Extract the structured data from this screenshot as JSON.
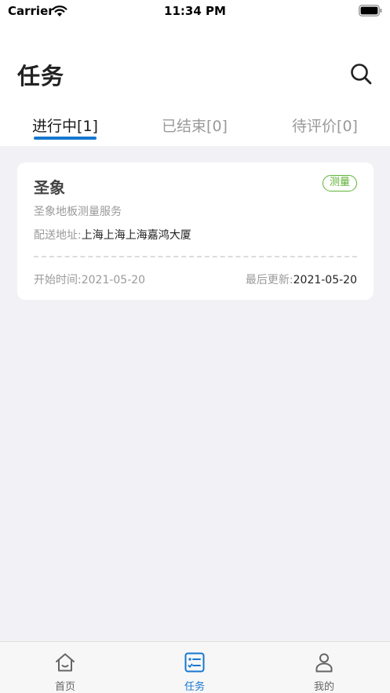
{
  "status_bar": {
    "carrier": "Carrier",
    "time": "11:34 PM"
  },
  "header": {
    "title": "任务",
    "search_icon": "search-icon"
  },
  "tabs": [
    {
      "label": "进行中[1]",
      "active": true
    },
    {
      "label": "已结束[0]",
      "active": false
    },
    {
      "label": "待评价[0]",
      "active": false
    }
  ],
  "task_card": {
    "title": "圣象",
    "tag": "测量",
    "description": "圣象地板测量服务",
    "address_label": "配送地址:",
    "address_value": "上海上海上海嘉鸿大厦",
    "start_label": "开始时间:",
    "start_value": "2021-05-20",
    "update_label": "最后更新:",
    "update_value": "2021-05-20"
  },
  "bottom_nav": [
    {
      "label": "首页",
      "icon": "home-icon",
      "active": false
    },
    {
      "label": "任务",
      "icon": "task-list-icon",
      "active": true
    },
    {
      "label": "我的",
      "icon": "person-icon",
      "active": false
    }
  ],
  "colors": {
    "accent": "#1677cf",
    "tag_green": "#5fb236",
    "background": "#f2f2f6"
  }
}
